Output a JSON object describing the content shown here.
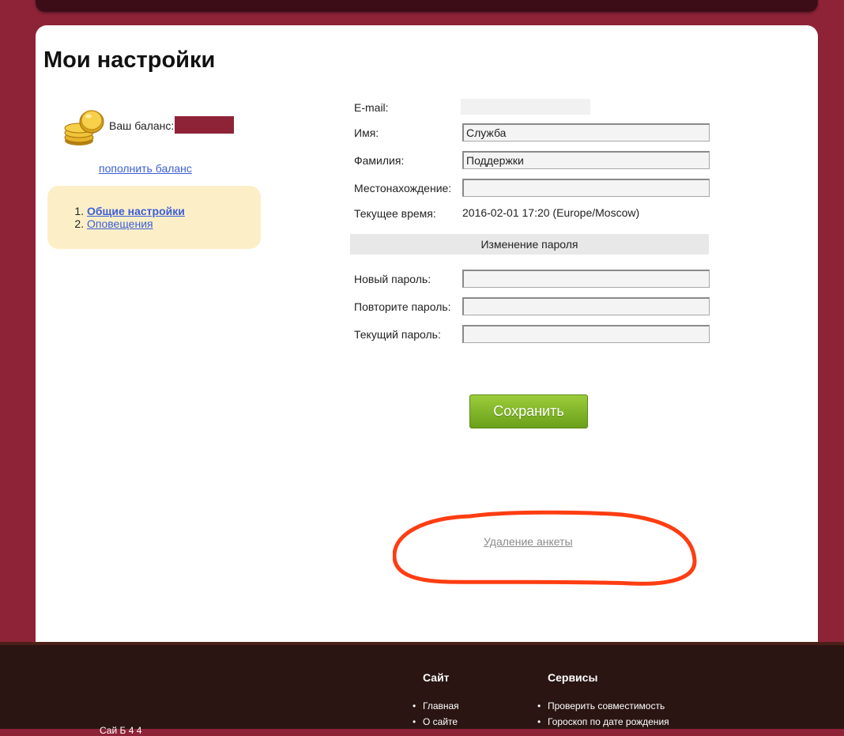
{
  "page": {
    "title": "Мои настройки"
  },
  "balance": {
    "label": "Ваш баланс:",
    "topup_link": "пополнить баланс"
  },
  "settings_menu": [
    {
      "number": "1.",
      "label": "Общие настройки",
      "active": true
    },
    {
      "number": "2.",
      "label": "Оповещения",
      "active": false
    }
  ],
  "form": {
    "email_label": "E-mail:",
    "first_name_label": "Имя:",
    "first_name_value": "Служба",
    "last_name_label": "Фамилия:",
    "last_name_value": "Поддержки",
    "location_label": "Местонахождение:",
    "location_value": "",
    "current_time_label": "Текущее время:",
    "current_time_value": "2016-02-01 17:20 (Europe/Moscow)"
  },
  "password_section": {
    "heading": "Изменение пароля",
    "new_password_label": "Новый пароль:",
    "repeat_password_label": "Повторите пароль:",
    "current_password_label": "Текущий пароль:"
  },
  "actions": {
    "save_label": "Сохранить",
    "delete_profile_link": "Удаление анкеты"
  },
  "footer": {
    "site_heading": "Сайт",
    "site_links": [
      "Главная",
      "О сайте"
    ],
    "services_heading": "Сервисы",
    "services_links": [
      "Проверить совместимость",
      "Гороскоп по дате рождения"
    ],
    "cut_text": "Сай                   Б  4  4"
  },
  "colors": {
    "page_bg": "#8e2338",
    "footer_bg": "#2a1512",
    "save_green": "#7db526",
    "menu_bg": "#fcefc8",
    "annotation_red": "#ff3d12",
    "link_blue": "#3a5ed8"
  },
  "icons": {
    "balance": "gold-coins-icon"
  }
}
